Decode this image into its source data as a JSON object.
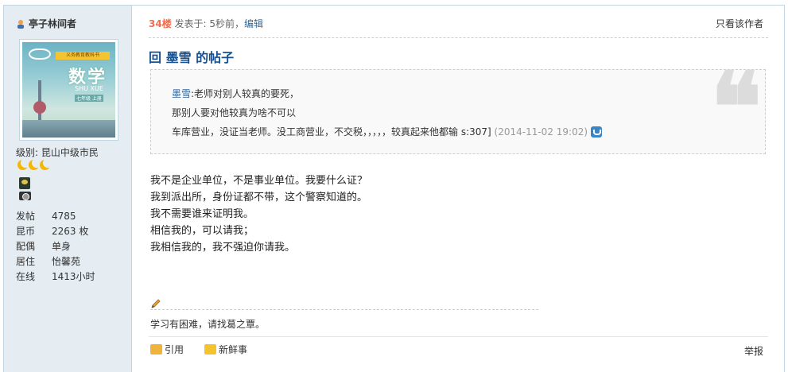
{
  "author": {
    "name": "亭子林间者",
    "icon": "user-icon"
  },
  "avatar": {
    "cover_band": "义务教育教科书",
    "cover_title": "数学",
    "cover_subtitle": "SHU XUE",
    "cover_grade": "七年级 上册"
  },
  "profile": {
    "level_label": "级别: 昆山中级市民",
    "stats": [
      {
        "key": "发帖",
        "value": "4785"
      },
      {
        "key": "昆币",
        "value": "2263 枚"
      },
      {
        "key": "配偶",
        "value": "单身"
      },
      {
        "key": "居住",
        "value": "怡馨苑"
      },
      {
        "key": "在线",
        "value": "1413小时"
      }
    ]
  },
  "post": {
    "floor": "34楼",
    "posted": "发表于: 5秒前，",
    "edit": "编辑",
    "only_author": "只看该作者",
    "title": "回 墨雪 的帖子",
    "quote": {
      "name": "墨雪",
      "line1": ":老师对别人较真的要死，",
      "line2": "那别人要对他较真为啥不可以",
      "line3": "车库营业，没证当老师。没工商营业，不交税，，，，，较真起来他都输 s:307]",
      "time": "(2014-11-02 19:02)"
    },
    "body": [
      "我不是企业单位，不是事业单位。我要什么证？",
      "我到派出所，身份证都不带，这个警察知道的。",
      "我不需要谁来证明我。",
      "相信我的，可以请我；",
      "我相信我的，我不强迫你请我。"
    ],
    "signature": "学习有困难，请找葛之覃。",
    "actions": {
      "quote": "引用",
      "news": "新鲜事",
      "report": "举报"
    }
  }
}
